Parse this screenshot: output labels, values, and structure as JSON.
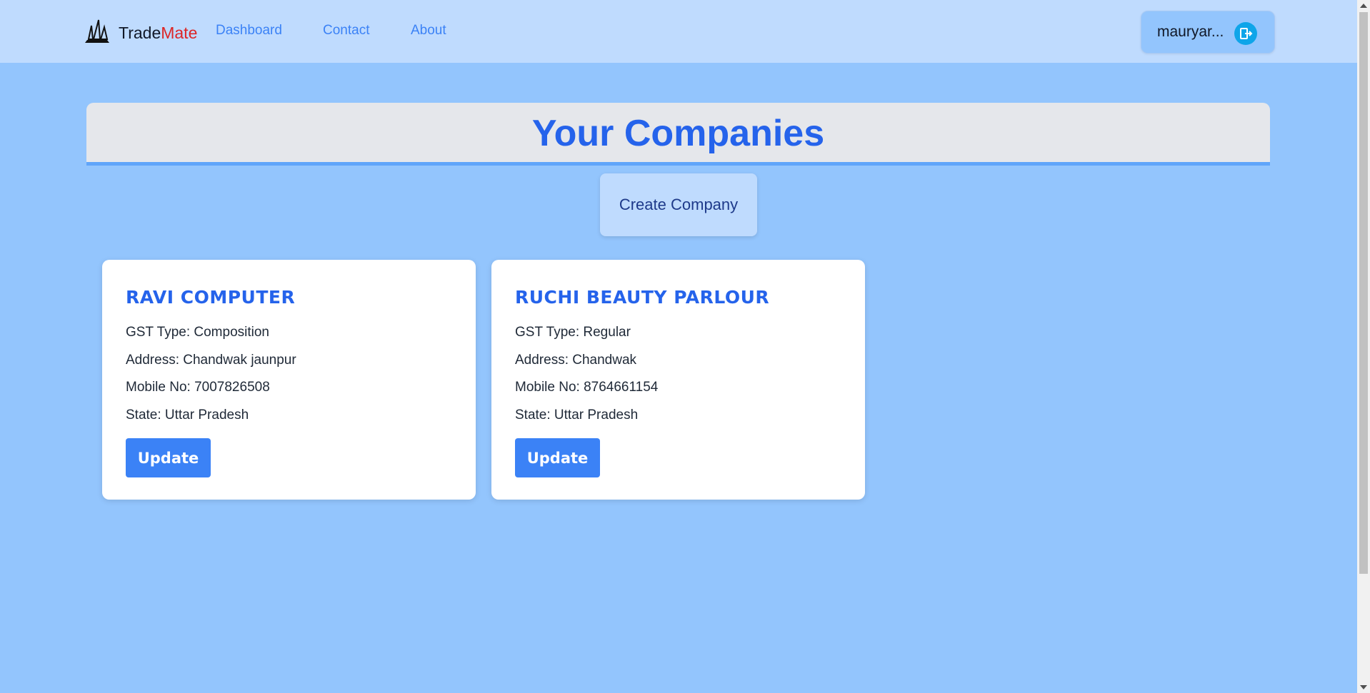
{
  "navbar": {
    "brand_part1": "Trade",
    "brand_part2": "Mate",
    "brand_icon": "sailboat-logo-icon",
    "links": [
      {
        "label": "Dashboard"
      },
      {
        "label": "Contact"
      },
      {
        "label": "About"
      }
    ],
    "user": {
      "name": "mauryar...",
      "icon": "logout-icon"
    }
  },
  "page": {
    "title": "Your Companies",
    "create_label": "Create Company"
  },
  "companies": [
    {
      "name": "RAVI COMPUTER",
      "gst": "GST Type: Composition",
      "address": "Address: Chandwak jaunpur",
      "mobile": "Mobile No: 7007826508",
      "state": "State: Uttar Pradesh",
      "update_label": "Update"
    },
    {
      "name": "RUCHI BEAUTY PARLOUR",
      "gst": "GST Type: Regular",
      "address": "Address: Chandwak",
      "mobile": "Mobile No: 8764661154",
      "state": "State: Uttar Pradesh",
      "update_label": "Update"
    }
  ],
  "colors": {
    "page_bg": "#93c5fd",
    "navbar_bg": "#bfdbfe",
    "accent": "#2563eb",
    "button": "#3b82f6",
    "brand_red": "#dc2626"
  }
}
